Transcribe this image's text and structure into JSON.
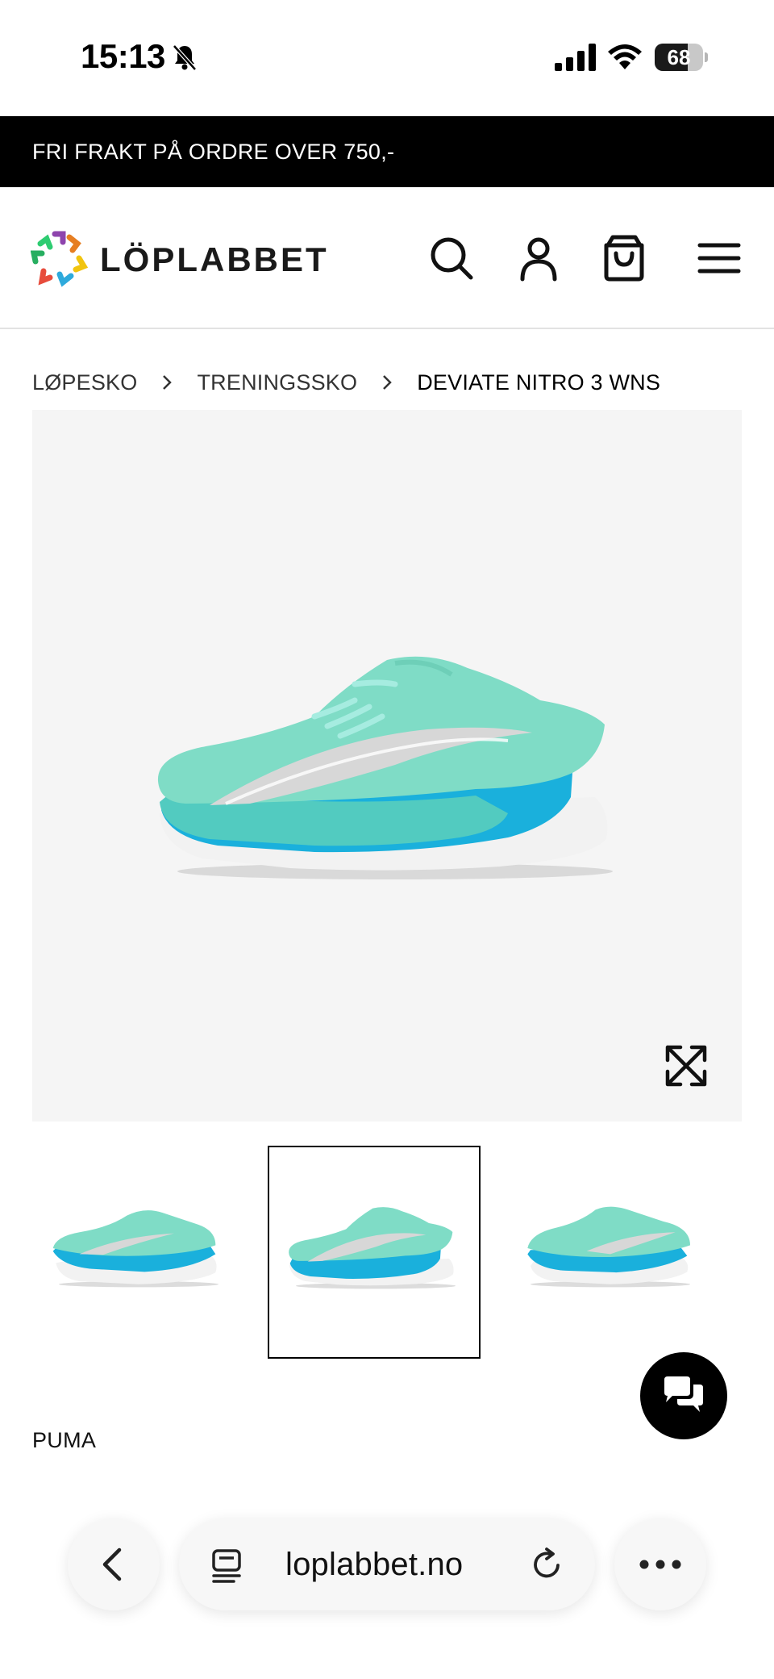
{
  "status_bar": {
    "time": "15:13",
    "battery_level": "68",
    "icons": [
      "bell-slash-icon",
      "signal-icon",
      "wifi-icon",
      "battery-icon"
    ]
  },
  "promo": {
    "text": "FRI FRAKT PÅ ORDRE OVER 750,-"
  },
  "header": {
    "logo_text": "LÖPLABBET",
    "icons": [
      "search-icon",
      "account-icon",
      "cart-icon",
      "menu-icon"
    ]
  },
  "breadcrumb": {
    "items": [
      "LØPESKO",
      "TRENINGSSKO",
      "DEVIATE NITRO 3 WNS"
    ]
  },
  "gallery": {
    "thumbnails": 3,
    "selected_index": 1,
    "colors": {
      "upper": "#7fdcc6",
      "midsole_blue": "#1ab0dc",
      "sole": "#f2f2f2",
      "background": "#f5f5f5"
    }
  },
  "product": {
    "brand": "PUMA"
  },
  "browser": {
    "url": "loplabbet.no"
  }
}
